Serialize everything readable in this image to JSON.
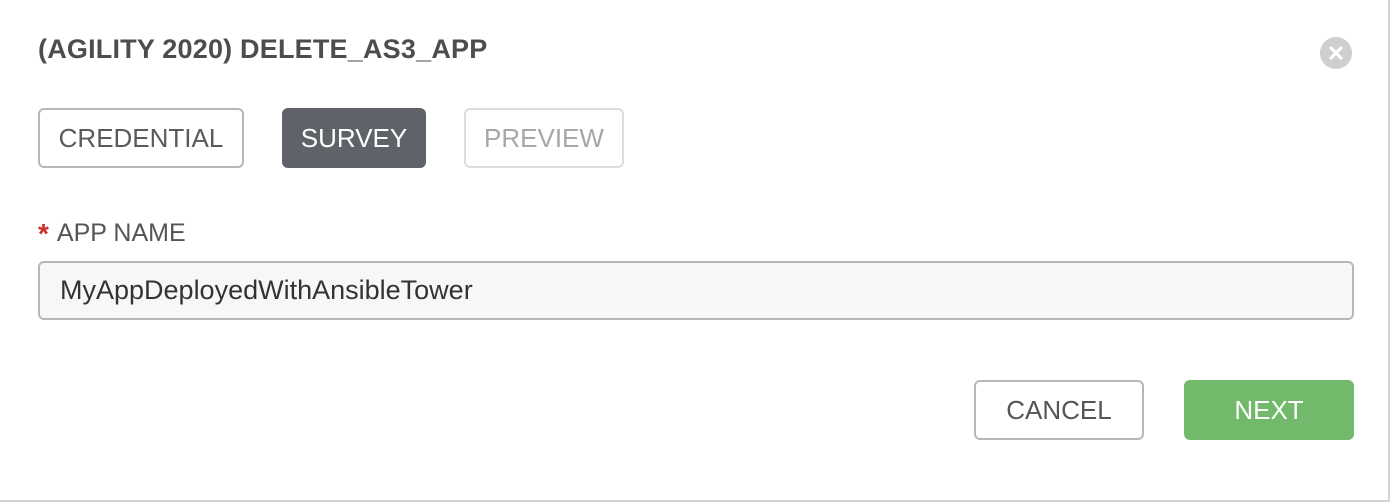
{
  "dialog": {
    "title": "(AGILITY 2020) DELETE_AS3_APP",
    "close_icon": "close-circle-icon"
  },
  "tabs": [
    {
      "label": "CREDENTIAL",
      "state": "default"
    },
    {
      "label": "SURVEY",
      "state": "active"
    },
    {
      "label": "PREVIEW",
      "state": "disabled"
    }
  ],
  "form": {
    "app_name": {
      "required_marker": "*",
      "label": "APP NAME",
      "value": "MyAppDeployedWithAnsibleTower"
    }
  },
  "actions": {
    "cancel_label": "CANCEL",
    "next_label": "NEXT"
  },
  "colors": {
    "active_tab": "#5f6369",
    "next_button": "#72b96b",
    "required_star": "#c9302c",
    "close_button": "#cfcfcf"
  }
}
